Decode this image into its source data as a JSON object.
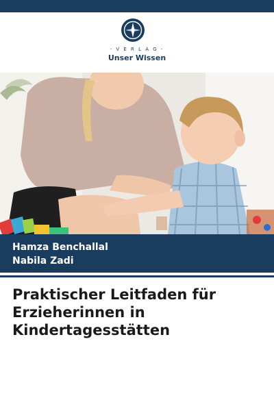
{
  "publisher": {
    "verlag_label": "- V E R L A G -",
    "name": "Unser Wissen"
  },
  "authors": [
    "Hamza Benchallal",
    "Nabila Zadi"
  ],
  "title_lines": [
    "Praktischer Leitfaden für",
    "Erzieherinnen in",
    "Kindertagesstätten"
  ],
  "colors": {
    "brand_navy": "#1a3c5e",
    "title_text": "#1a1a1a"
  },
  "icons": {
    "publisher_logo": "compass-rose-emblem"
  }
}
